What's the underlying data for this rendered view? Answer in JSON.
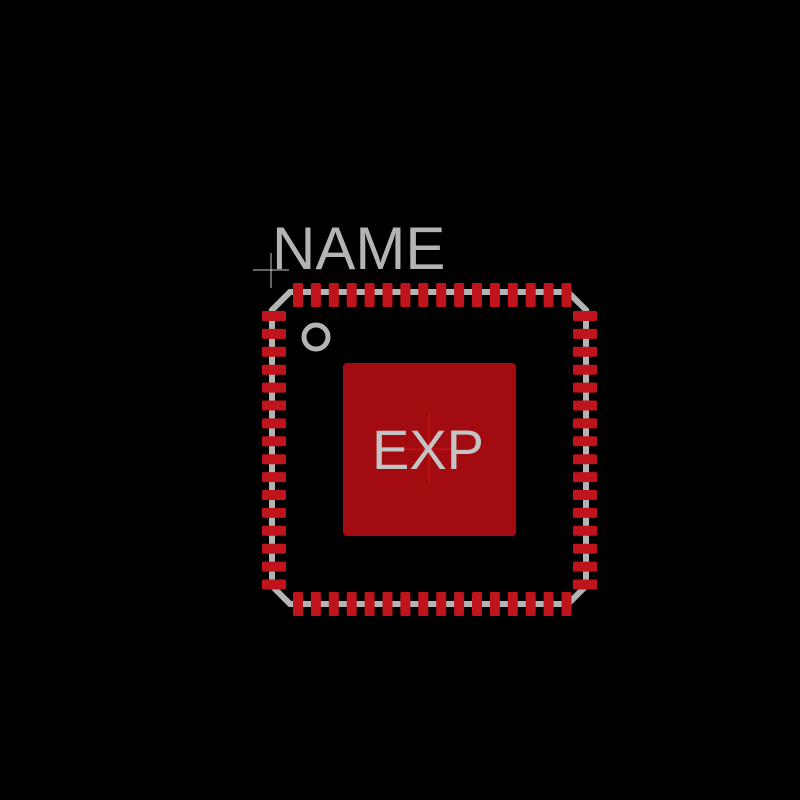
{
  "footprint": {
    "name_label": "NAME",
    "exposed_pad_label": "EXP",
    "pins_per_side": 16,
    "colors": {
      "background": "#000000",
      "pad": "#c0141c",
      "exposed_pad": "#a20c10",
      "silkscreen": "#b4b4b4",
      "origin_marker": "#c8c8c8",
      "center_marker": "#d21919"
    },
    "icons": {
      "pin1": "pin1-marker-icon",
      "origin": "origin-crosshair-icon",
      "center": "center-crosshair-icon"
    }
  }
}
